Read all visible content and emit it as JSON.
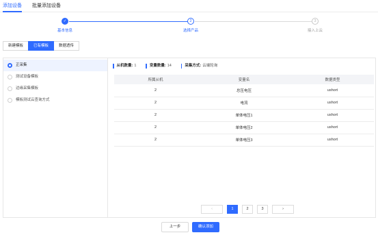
{
  "top_tabs": [
    {
      "label": "添加设备",
      "active": true
    },
    {
      "label": "批量添加设备",
      "active": false
    }
  ],
  "steps": [
    {
      "number": "✓",
      "label": "基本信息",
      "state": "done"
    },
    {
      "number": "2",
      "label": "选择产品",
      "state": "current"
    },
    {
      "number": "3",
      "label": "接入上云",
      "state": "todo"
    }
  ],
  "sub_tabs": [
    {
      "label": "新建模板",
      "active": false
    },
    {
      "label": "已有模板",
      "active": true
    },
    {
      "label": "数据透传",
      "active": false
    }
  ],
  "sidebar": {
    "items": [
      {
        "label": "正采集",
        "selected": true
      },
      {
        "label": "测试设备模板",
        "selected": false
      },
      {
        "label": "边缘采集模板",
        "selected": false
      },
      {
        "label": "模板测试云查询方式",
        "selected": false
      }
    ]
  },
  "info": {
    "slave_label": "从机数量:",
    "slave_value": "1",
    "var_label": "变量数量:",
    "var_value": "14",
    "mode_label": "采集方式:",
    "mode_value": "云端轮询"
  },
  "table": {
    "headers": [
      "所属从机",
      "变量名",
      "数据类型"
    ],
    "rows": [
      [
        "2",
        "总压电压",
        "ushort"
      ],
      [
        "2",
        "电流",
        "ushort"
      ],
      [
        "2",
        "单体电压1",
        "ushort"
      ],
      [
        "2",
        "单体电压2",
        "ushort"
      ],
      [
        "2",
        "单体电压3",
        "ushort"
      ]
    ]
  },
  "pagination": {
    "prev": "‹",
    "pages": [
      "1",
      "2",
      "3"
    ],
    "current": "1",
    "next": "›"
  },
  "footer": {
    "prev_label": "上一步",
    "confirm_label": "确认添加"
  },
  "colors": {
    "accent": "#2f6bff"
  }
}
